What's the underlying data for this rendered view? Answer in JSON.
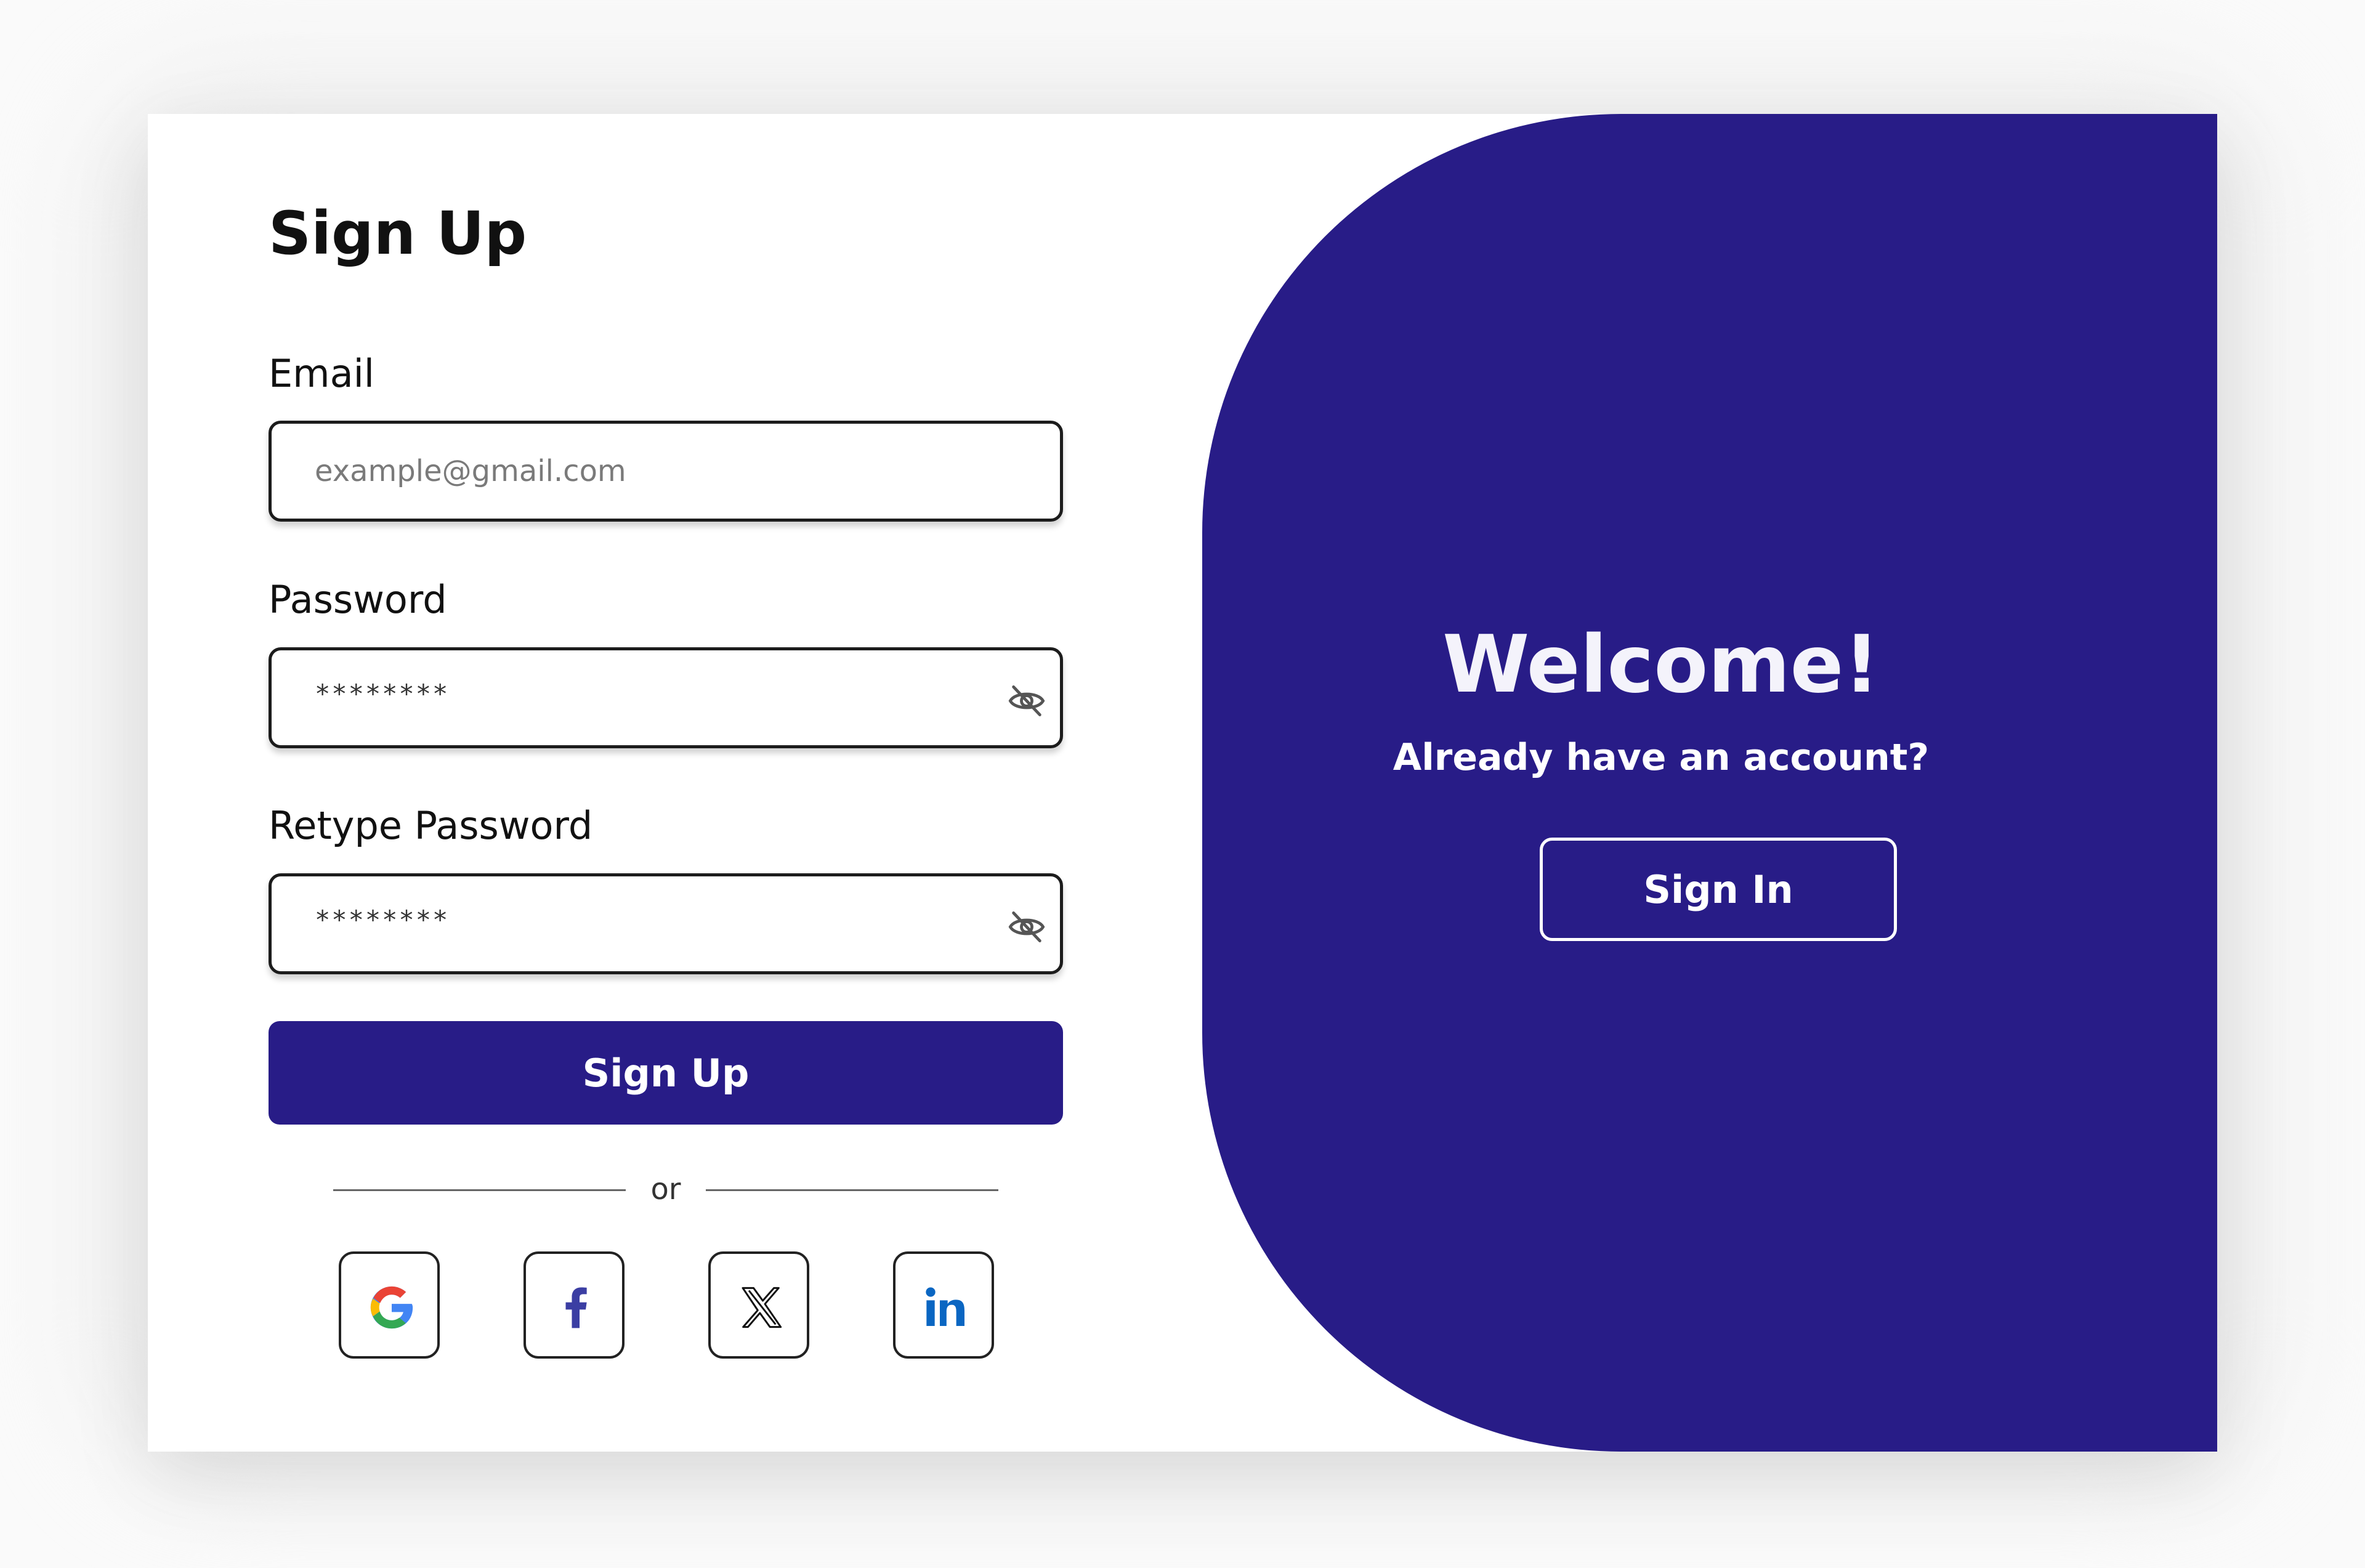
{
  "colors": {
    "primary": "#281c87",
    "panel_text": "#ffffff",
    "google_blue": "#4285F4",
    "google_red": "#EA4335",
    "google_yellow": "#FBBC05",
    "google_green": "#34A853",
    "facebook": "#3b3ea3",
    "linkedin": "#0a66c2"
  },
  "signup": {
    "title": "Sign Up",
    "email": {
      "label": "Email",
      "placeholder": "example@gmail.com",
      "value": ""
    },
    "password": {
      "label": "Password",
      "value": "********",
      "toggle_icon": "eye-off-icon"
    },
    "retype_password": {
      "label": "Retype Password",
      "value": "********",
      "toggle_icon": "eye-off-icon"
    },
    "submit_label": "Sign Up",
    "divider_text": "or",
    "social": [
      {
        "name": "google",
        "icon": "google-icon"
      },
      {
        "name": "facebook",
        "icon": "facebook-icon"
      },
      {
        "name": "x",
        "icon": "x-icon"
      },
      {
        "name": "linkedin",
        "icon": "linkedin-icon"
      }
    ]
  },
  "welcome_panel": {
    "heading": "Welcome!",
    "subtext": "Already have an account?",
    "signin_label": "Sign In"
  }
}
